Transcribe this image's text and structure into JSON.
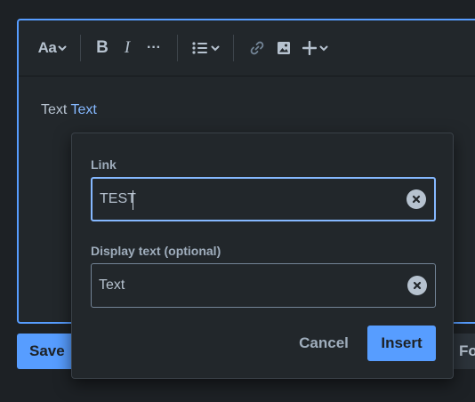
{
  "toolbar": {
    "text_style_label": "Aa",
    "bold_label": "B",
    "italic_label": "I",
    "more_label": "···"
  },
  "editor": {
    "text_plain": "Text",
    "text_link": "Text"
  },
  "actions": {
    "save_label": "Save",
    "format_label": "Fo"
  },
  "link_dialog": {
    "link_label": "Link",
    "link_value": "TEST",
    "display_label": "Display text (optional)",
    "display_value": "Text",
    "cancel_label": "Cancel",
    "insert_label": "Insert"
  },
  "colors": {
    "accent": "#579dff",
    "background": "#1d2125",
    "surface": "#22272b",
    "link_text": "#85b8ff"
  },
  "icons": [
    "chevron-down-icon",
    "bullet-list-icon",
    "link-icon",
    "image-icon",
    "plus-icon",
    "clear-icon"
  ]
}
